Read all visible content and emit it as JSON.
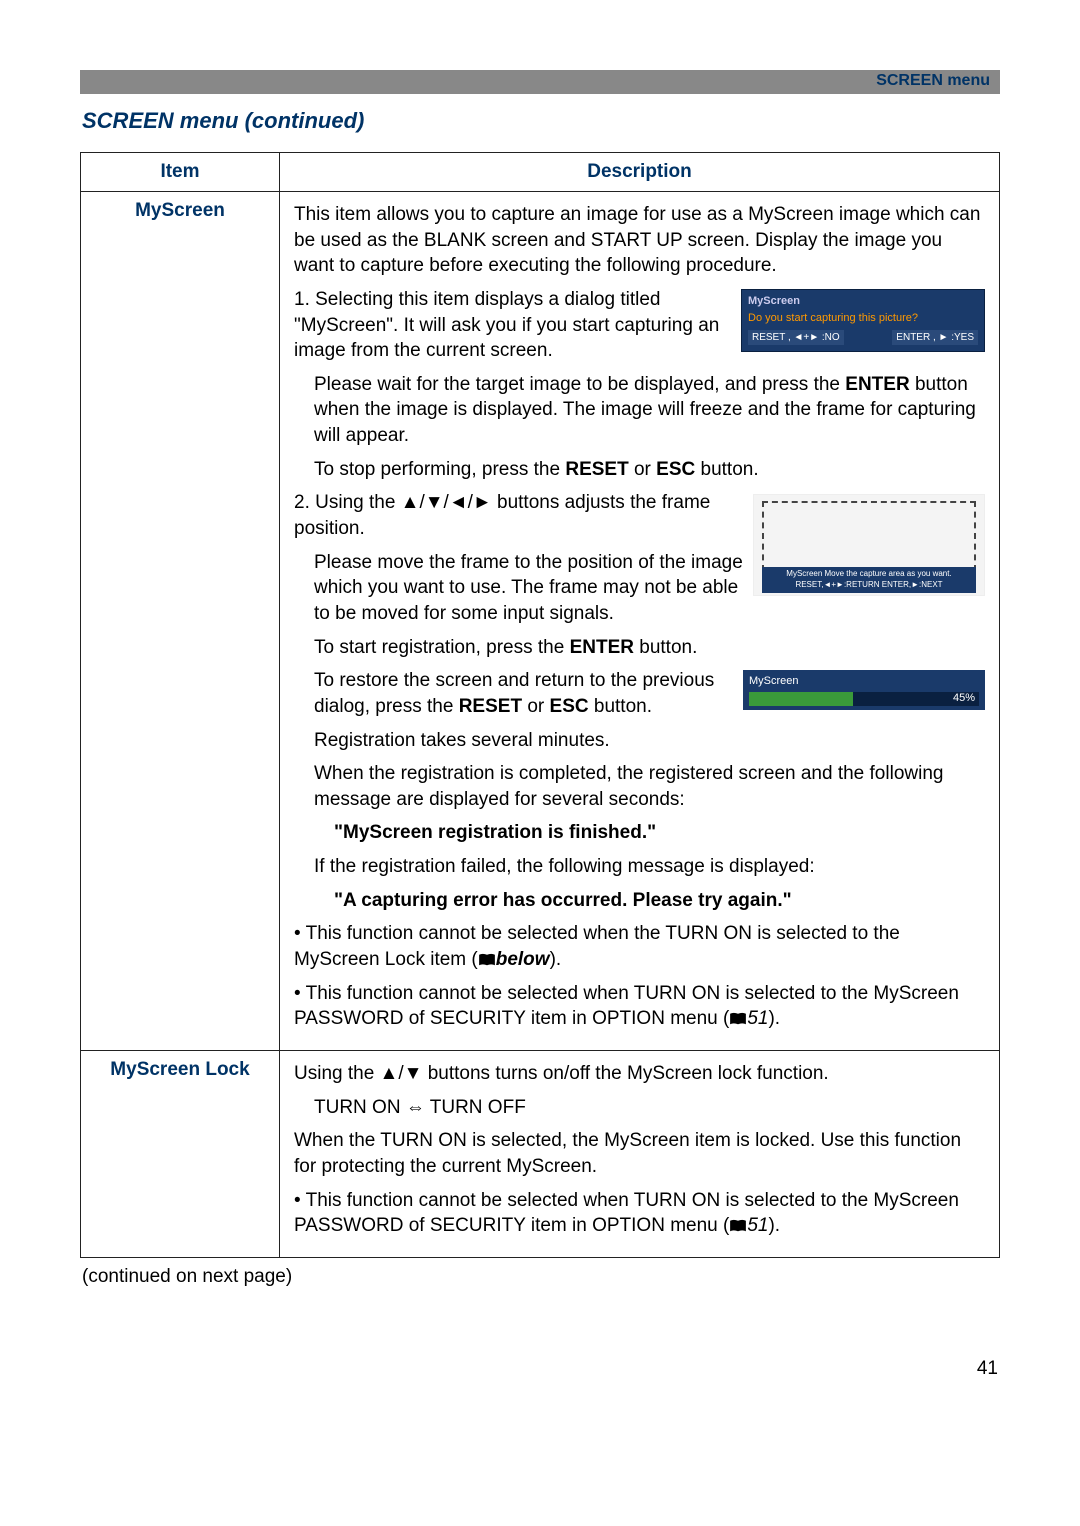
{
  "header": {
    "label": "SCREEN menu"
  },
  "section_title": "SCREEN menu (continued)",
  "table": {
    "header_item": "Item",
    "header_desc": "Description",
    "rows": [
      {
        "item": "MyScreen",
        "intro": "This item allows you to capture an image for use as a MyScreen image which can be used as the BLANK screen and START UP screen. Display the image you want to capture before executing the following procedure.",
        "step1_a": "1. Selecting this item displays a dialog titled \"MyScreen\". It will ask you if you start capturing an image from the current screen.",
        "step1_b_prefix": "Please wait for the target image to be displayed, and press the ",
        "step1_b_enter": "ENTER",
        "step1_b_mid": " button when the image is displayed. The image will freeze and the frame for capturing will appear.",
        "step1_c_prefix": "To stop performing, press the ",
        "step1_c_reset": "RESET",
        "step1_c_or": " or ",
        "step1_c_esc": "ESC",
        "step1_c_suffix": " button.",
        "step2_a": "2. Using the ▲/▼/◄/► buttons adjusts the frame position.",
        "step2_b": "Please move the frame to the position of the image which you want to use. The frame may not be able to be moved for some input signals.",
        "step2_c_prefix": "To start registration, press the ",
        "step2_c_enter": "ENTER",
        "step2_c_suffix": " button.",
        "step2_d_prefix": "To restore the screen and return to the previous dialog, press the ",
        "step2_d_reset": "RESET",
        "step2_d_or": " or ",
        "step2_d_esc": "ESC",
        "step2_d_suffix": " button.",
        "step2_e": "Registration takes several minutes.",
        "result_a": "When the registration is completed, the registered screen and the following message are displayed for several seconds:",
        "result_msg1": "\"MyScreen registration is finished.\"",
        "result_b": "If the registration failed, the following message is displayed:",
        "result_msg2": "\"A capturing error has occurred. Please try again.\"",
        "note1_prefix": "• This function cannot be selected when the TURN ON is selected to the MyScreen Lock item (",
        "note1_ref": "below",
        "note1_suffix": ").",
        "note2_prefix": "• This function cannot be selected when TURN ON is selected to the MyScreen PASSWORD of SECURITY item in OPTION menu (",
        "note2_ref": "51",
        "note2_suffix": ").",
        "dialog1": {
          "title": "MyScreen",
          "question": "Do you start capturing this picture?",
          "btn_no": "RESET , ◄+► :NO",
          "btn_yes": "ENTER , ► :YES"
        },
        "frame_mini": "MyScreen  Move the capture area as you want.  RESET,◄+►:RETURN  ENTER,►:NEXT",
        "progress": {
          "title": "MyScreen",
          "percent": "45%"
        }
      },
      {
        "item": "MyScreen Lock",
        "line1": "Using the ▲/▼ buttons turns on/off the MyScreen lock function.",
        "toggle": "TURN ON ⇔ TURN OFF",
        "line2": "When the TURN ON is selected, the MyScreen item is locked. Use this function for protecting the current MyScreen.",
        "note_prefix": "• This function cannot be selected when TURN ON is selected to the MyScreen PASSWORD of SECURITY item in OPTION menu (",
        "note_ref": "51",
        "note_suffix": ")."
      }
    ]
  },
  "footer_note": "(continued on next page)",
  "page_number": "41"
}
